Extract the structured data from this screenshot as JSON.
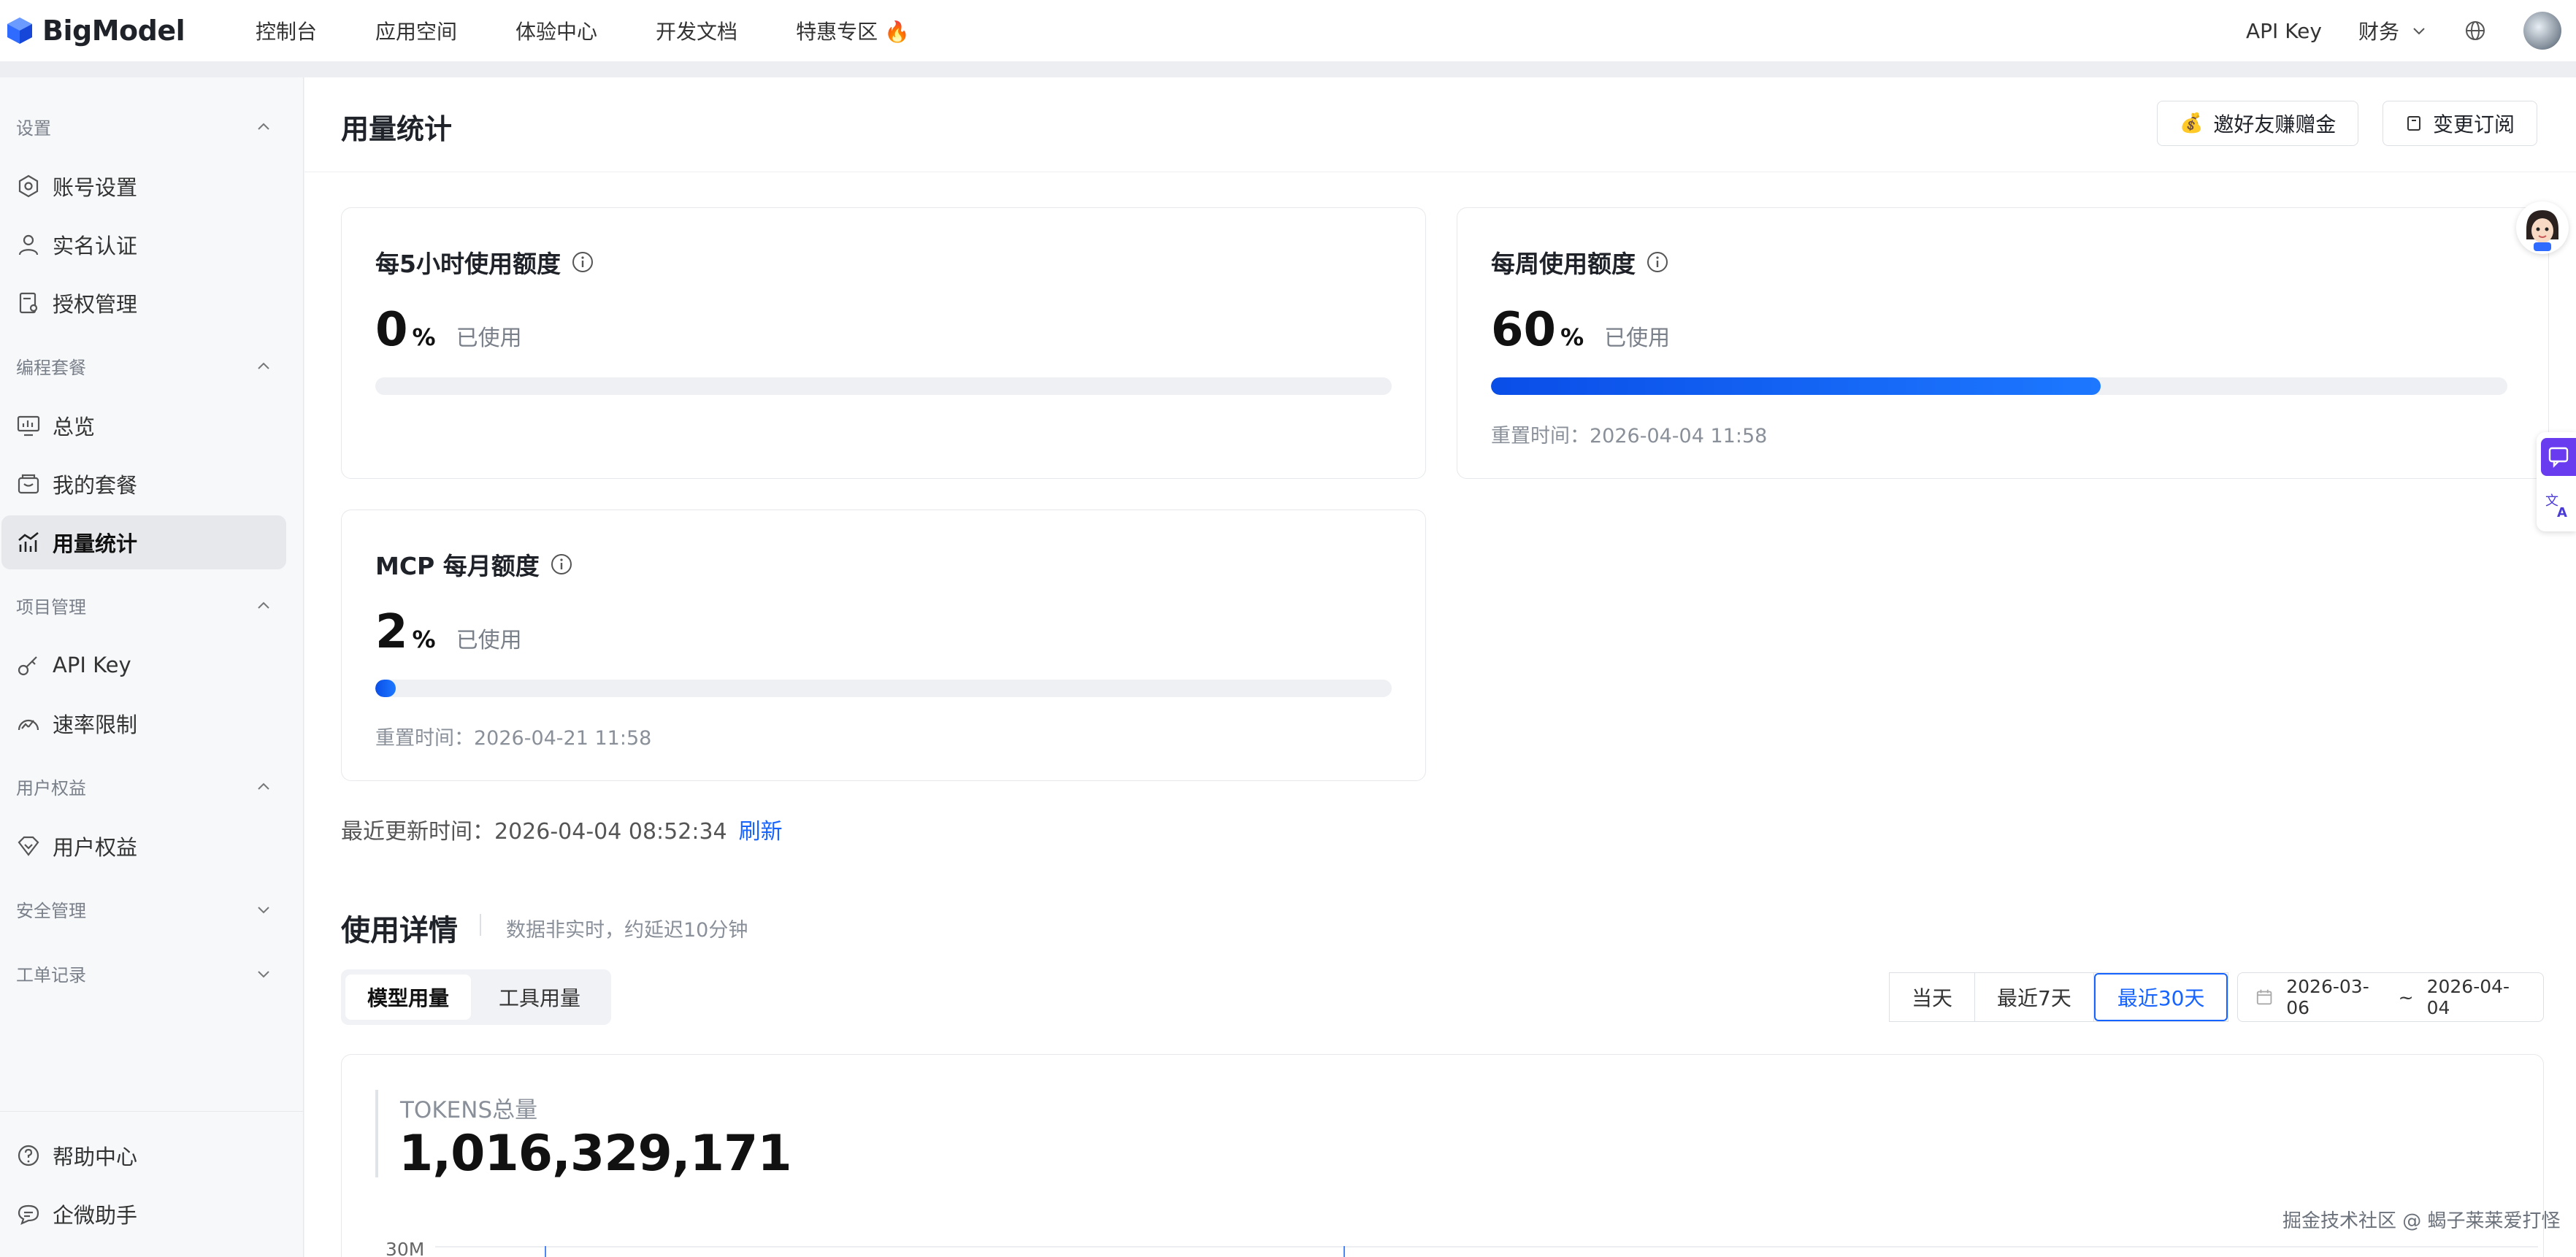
{
  "brand": {
    "name": "BigModel"
  },
  "topnav": [
    "控制台",
    "应用空间",
    "体验中心",
    "开发文档",
    "特惠专区 🔥"
  ],
  "topright": {
    "api_key": "API Key",
    "finance": "财务"
  },
  "sidebar": {
    "sections": [
      {
        "title": "设置",
        "items": [
          "账号设置",
          "实名认证",
          "授权管理"
        ]
      },
      {
        "title": "编程套餐",
        "items": [
          "总览",
          "我的套餐",
          "用量统计"
        ]
      },
      {
        "title": "项目管理",
        "items": [
          "API Key",
          "速率限制"
        ]
      },
      {
        "title": "用户权益",
        "items": [
          "用户权益"
        ]
      },
      {
        "title": "安全管理",
        "items": []
      },
      {
        "title": "工单记录",
        "items": []
      }
    ],
    "footer": [
      "帮助中心",
      "企微助手"
    ]
  },
  "page": {
    "title": "用量统计",
    "invite_button": "邀好友赚赠金",
    "change_sub_button": "变更订阅"
  },
  "quota": {
    "used_label": "已使用",
    "unit": "%",
    "five_hour": {
      "title": "每5小时使用额度",
      "percent": "0"
    },
    "weekly": {
      "title": "每周使用额度",
      "percent": "60",
      "reset": "重置时间：2026-04-04 11:58"
    },
    "mcp": {
      "title": "MCP 每月额度",
      "percent": "2",
      "reset": "重置时间：2026-04-21 11:58"
    }
  },
  "updated": {
    "label": "最近更新时间：2026-04-04 08:52:34",
    "refresh": "刷新"
  },
  "detail": {
    "title": "使用详情",
    "note": "数据非实时，约延迟10分钟",
    "tabs": [
      "模型用量",
      "工具用量"
    ],
    "ranges": [
      "当天",
      "最近7天",
      "最近30天"
    ],
    "date_start": "2026-03-06",
    "date_sep": "~",
    "date_end": "2026-04-04"
  },
  "tokens": {
    "label": "TOKENS总量",
    "value": "1,016,329,171",
    "ytick": "30M"
  },
  "watermark": "掘金技术社区 @ 蝎子莱莱爱打怪"
}
